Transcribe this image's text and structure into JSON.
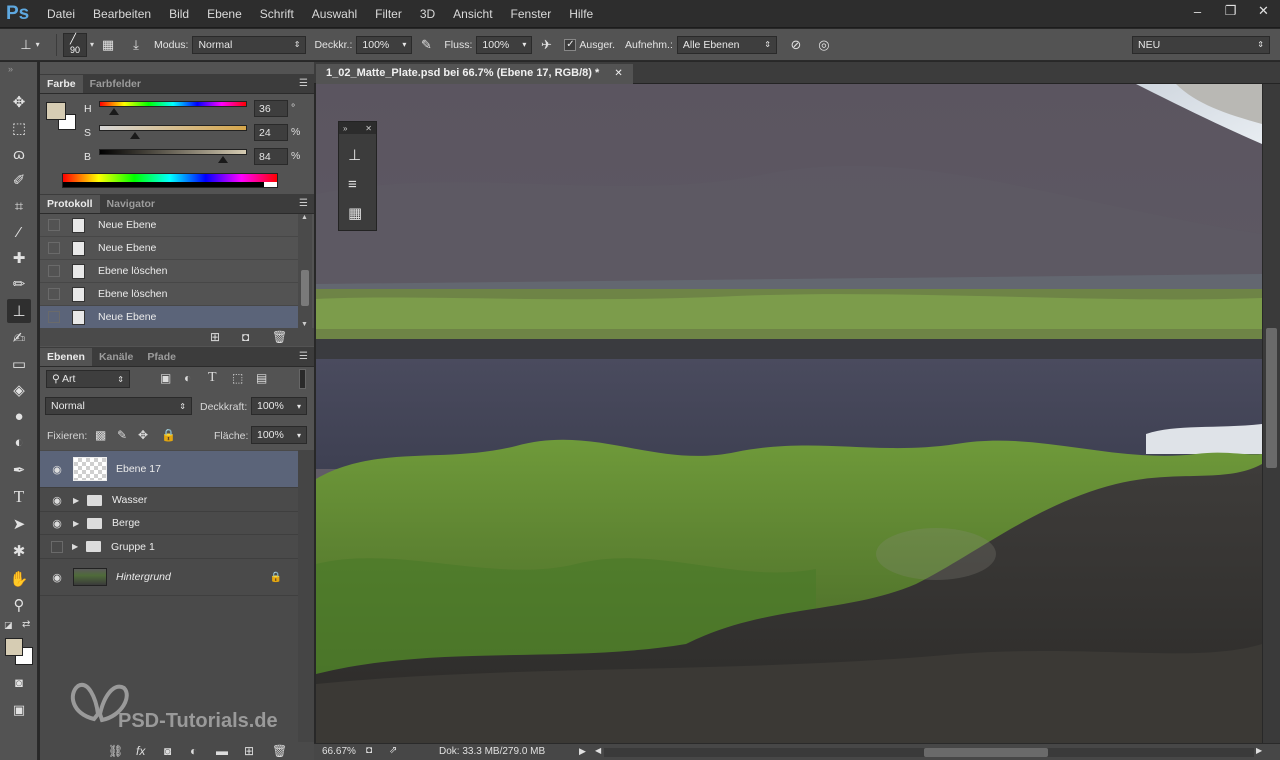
{
  "app": {
    "logo": "Ps"
  },
  "menu": [
    "Datei",
    "Bearbeiten",
    "Bild",
    "Ebene",
    "Schrift",
    "Auswahl",
    "Filter",
    "3D",
    "Ansicht",
    "Fenster",
    "Hilfe"
  ],
  "window_controls": {
    "minimize": "–",
    "restore": "❐",
    "close": "✕"
  },
  "options": {
    "brush_size": "90",
    "mode_label": "Modus:",
    "mode_value": "Normal",
    "opacity_label": "Deckkr.:",
    "opacity_value": "100%",
    "flow_label": "Fluss:",
    "flow_value": "100%",
    "aligned_label": "Ausger.",
    "aligned_checked": "✓",
    "sample_label": "Aufnehm.:",
    "sample_value": "Alle Ebenen",
    "workspace_value": "NEU"
  },
  "color_panel": {
    "tabs": [
      "Farbe",
      "Farbfelder"
    ],
    "h_label": "H",
    "h_value": "36",
    "h_unit": "°",
    "s_label": "S",
    "s_value": "24",
    "s_unit": "%",
    "b_label": "B",
    "b_value": "84",
    "b_unit": "%",
    "foreground_color": "#d6ccb3",
    "h_fraction": 0.1,
    "s_fraction": 0.24,
    "b_fraction": 0.84
  },
  "history_panel": {
    "tabs": [
      "Protokoll",
      "Navigator"
    ],
    "items": [
      {
        "label": "Neue Ebene",
        "selected": false
      },
      {
        "label": "Neue Ebene",
        "selected": false
      },
      {
        "label": "Ebene löschen",
        "selected": false
      },
      {
        "label": "Ebene löschen",
        "selected": false
      },
      {
        "label": "Neue Ebene",
        "selected": true
      }
    ]
  },
  "layers_panel": {
    "tabs": [
      "Ebenen",
      "Kanäle",
      "Pfade"
    ],
    "filter_value": "Art",
    "blend_mode": "Normal",
    "opacity_label": "Deckkraft:",
    "opacity_value": "100%",
    "lock_label": "Fixieren:",
    "fill_label": "Fläche:",
    "fill_value": "100%",
    "layers": [
      {
        "name": "Ebene 17",
        "type": "layer",
        "visible": true,
        "selected": true
      },
      {
        "name": "Wasser",
        "type": "group",
        "visible": true,
        "selected": false
      },
      {
        "name": "Berge",
        "type": "group",
        "visible": true,
        "selected": false
      },
      {
        "name": "Gruppe 1",
        "type": "group",
        "visible": false,
        "selected": false
      },
      {
        "name": "Hintergrund",
        "type": "background",
        "visible": true,
        "selected": false
      }
    ]
  },
  "document": {
    "tab_title": "1_02_Matte_Plate.psd bei 66.7% (Ebene 17, RGB/8) *",
    "close": "✕"
  },
  "status": {
    "zoom": "66.67%",
    "doc_info": "Dok: 33.3 MB/279.0 MB"
  },
  "watermark": {
    "text": "PSD-Tutorials.de"
  }
}
